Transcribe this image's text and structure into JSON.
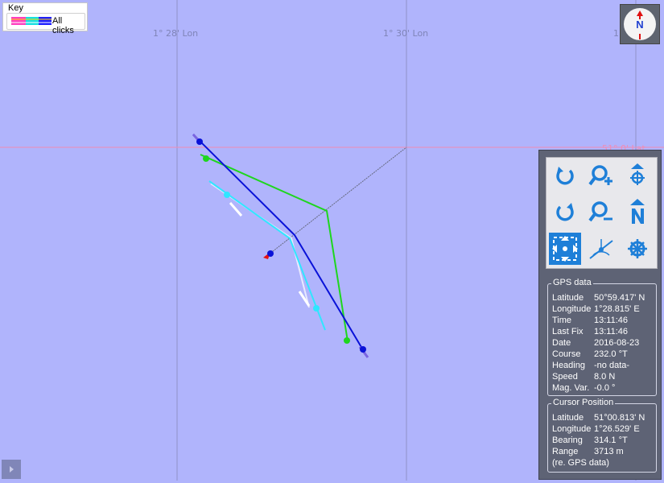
{
  "map": {
    "lon_labels": [
      "1° 28' Lon",
      "1° 30' Lon",
      "1°"
    ],
    "lat_label": "51° 0' Lat",
    "tracks": [
      {
        "name": "blue",
        "color": "#0a12d8"
      },
      {
        "name": "green",
        "color": "#1ed61e"
      },
      {
        "name": "cyan",
        "color": "#30e6ff"
      },
      {
        "name": "white",
        "color": "#f6f6ff"
      }
    ]
  },
  "key": {
    "title": "Key",
    "label": "All clicks",
    "swatch_colors": [
      "#ff40c0",
      "#18e0e0",
      "#2020ff",
      "#ffd800"
    ]
  },
  "compass": {
    "label": "N",
    "icon": "north-arrow-icon"
  },
  "tools": [
    {
      "name": "rotate-clockwise-icon"
    },
    {
      "name": "zoom-in-icon"
    },
    {
      "name": "boat-up-icon"
    },
    {
      "name": "rotate-anticlockwise-icon"
    },
    {
      "name": "zoom-out-icon"
    },
    {
      "name": "north-up-icon"
    },
    {
      "name": "fit-view-icon"
    },
    {
      "name": "measure-bearing-icon"
    },
    {
      "name": "ship-wheel-icon"
    }
  ],
  "gps": {
    "title": "GPS data",
    "rows": [
      {
        "label": "Latitude",
        "value": "50°59.417' N"
      },
      {
        "label": "Longitude",
        "value": "1°28.815' E"
      },
      {
        "label": "Time",
        "value": "13:11:46"
      },
      {
        "label": "Last Fix",
        "value": "13:11:46"
      },
      {
        "label": "Date",
        "value": "2016-08-23"
      },
      {
        "label": "Course",
        "value": "232.0 °T"
      },
      {
        "label": "Heading",
        "value": "-no data-"
      },
      {
        "label": "Speed",
        "value": "8.0 N"
      },
      {
        "label": "Mag. Var.",
        "value": "-0.0 °"
      }
    ]
  },
  "cursor": {
    "title": "Cursor Position",
    "rows": [
      {
        "label": "Latitude",
        "value": "51°00.813' N"
      },
      {
        "label": "Longitude",
        "value": "1°26.529' E"
      },
      {
        "label": "Bearing",
        "value": "314.1 °T"
      },
      {
        "label": "Range",
        "value": "3713 m"
      }
    ],
    "note": "(re. GPS data)"
  }
}
